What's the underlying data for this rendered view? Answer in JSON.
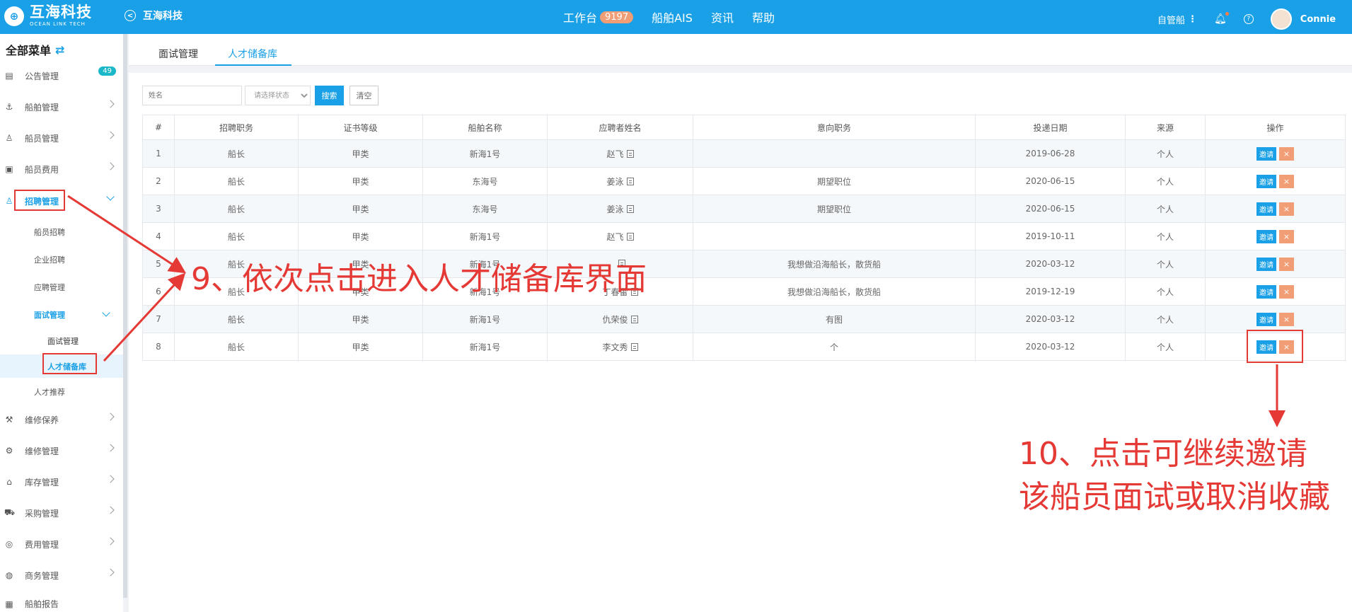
{
  "header": {
    "brand_name": "互海科技",
    "brand_sub": "OCEAN LINK TECH",
    "back_label": "互海科技",
    "nav": [
      {
        "label": "工作台",
        "badge": "9197"
      },
      {
        "label": "船舶AIS"
      },
      {
        "label": "资讯"
      },
      {
        "label": "帮助"
      }
    ],
    "ship_selector": "自管船",
    "user_name": "Connie"
  },
  "sidebar": {
    "title": "全部菜单",
    "items": [
      {
        "label": "公告管理",
        "icon": "notice-icon",
        "count": "49"
      },
      {
        "label": "船舶管理",
        "icon": "anchor-icon"
      },
      {
        "label": "船员管理",
        "icon": "user-icon"
      },
      {
        "label": "船员费用",
        "icon": "wallet-icon"
      },
      {
        "label": "招聘管理",
        "icon": "user-icon"
      },
      {
        "label": "维修保养",
        "icon": "tool-icon"
      },
      {
        "label": "维修管理",
        "icon": "wrench-icon"
      },
      {
        "label": "库存管理",
        "icon": "warehouse-icon"
      },
      {
        "label": "采购管理",
        "icon": "cart-icon"
      },
      {
        "label": "费用管理",
        "icon": "coins-icon"
      },
      {
        "label": "商务管理",
        "icon": "globe-icon"
      },
      {
        "label": "船舶报告",
        "icon": "report-icon"
      }
    ],
    "recruit_sub": [
      "船员招聘",
      "企业招聘",
      "应聘管理",
      "面试管理",
      "人才推荐"
    ],
    "interview_sub": [
      "面试管理",
      "人才储备库"
    ]
  },
  "tabs": [
    "面试管理",
    "人才储备库"
  ],
  "filters": {
    "name_placeholder": "姓名",
    "status_placeholder": "请选择状态",
    "search_label": "搜索",
    "clear_label": "清空"
  },
  "table": {
    "columns": [
      "#",
      "招聘职务",
      "证书等级",
      "船舶名称",
      "应聘者姓名",
      "意向职务",
      "投递日期",
      "来源",
      "操作"
    ],
    "rows": [
      {
        "no": "1",
        "position": "船长",
        "cert": "甲类",
        "ship": "新海1号",
        "name": "赵飞",
        "intent": "",
        "date": "2019-06-28",
        "source": "个人"
      },
      {
        "no": "2",
        "position": "船长",
        "cert": "甲类",
        "ship": "东海号",
        "name": "姜泳",
        "intent": "期望职位",
        "date": "2020-06-15",
        "source": "个人"
      },
      {
        "no": "3",
        "position": "船长",
        "cert": "甲类",
        "ship": "东海号",
        "name": "姜泳",
        "intent": "期望职位",
        "date": "2020-06-15",
        "source": "个人"
      },
      {
        "no": "4",
        "position": "船长",
        "cert": "甲类",
        "ship": "新海1号",
        "name": "赵飞",
        "intent": "",
        "date": "2019-10-11",
        "source": "个人"
      },
      {
        "no": "5",
        "position": "船长",
        "cert": "甲类",
        "ship": "新海1号",
        "name": "",
        "intent": "我想做沿海船长，散货船",
        "date": "2020-03-12",
        "source": "个人"
      },
      {
        "no": "6",
        "position": "船长",
        "cert": "甲类",
        "ship": "新海1号",
        "name": "丁春雷",
        "intent": "我想做沿海船长，散货船",
        "date": "2019-12-19",
        "source": "个人"
      },
      {
        "no": "7",
        "position": "船长",
        "cert": "甲类",
        "ship": "新海1号",
        "name": "仇荣俊",
        "intent": "有图",
        "date": "2020-03-12",
        "source": "个人"
      },
      {
        "no": "8",
        "position": "船长",
        "cert": "甲类",
        "ship": "新海1号",
        "name": "李文秀",
        "intent": "个",
        "date": "2020-03-12",
        "source": "个人"
      }
    ],
    "invite_label": "邀请",
    "cancel_label": "×"
  },
  "annotations": {
    "step9": "9、依次点击进入人才储备库界面",
    "step10_line1": "10、点击可继续邀请",
    "step10_line2": "该船员面试或取消收藏"
  }
}
